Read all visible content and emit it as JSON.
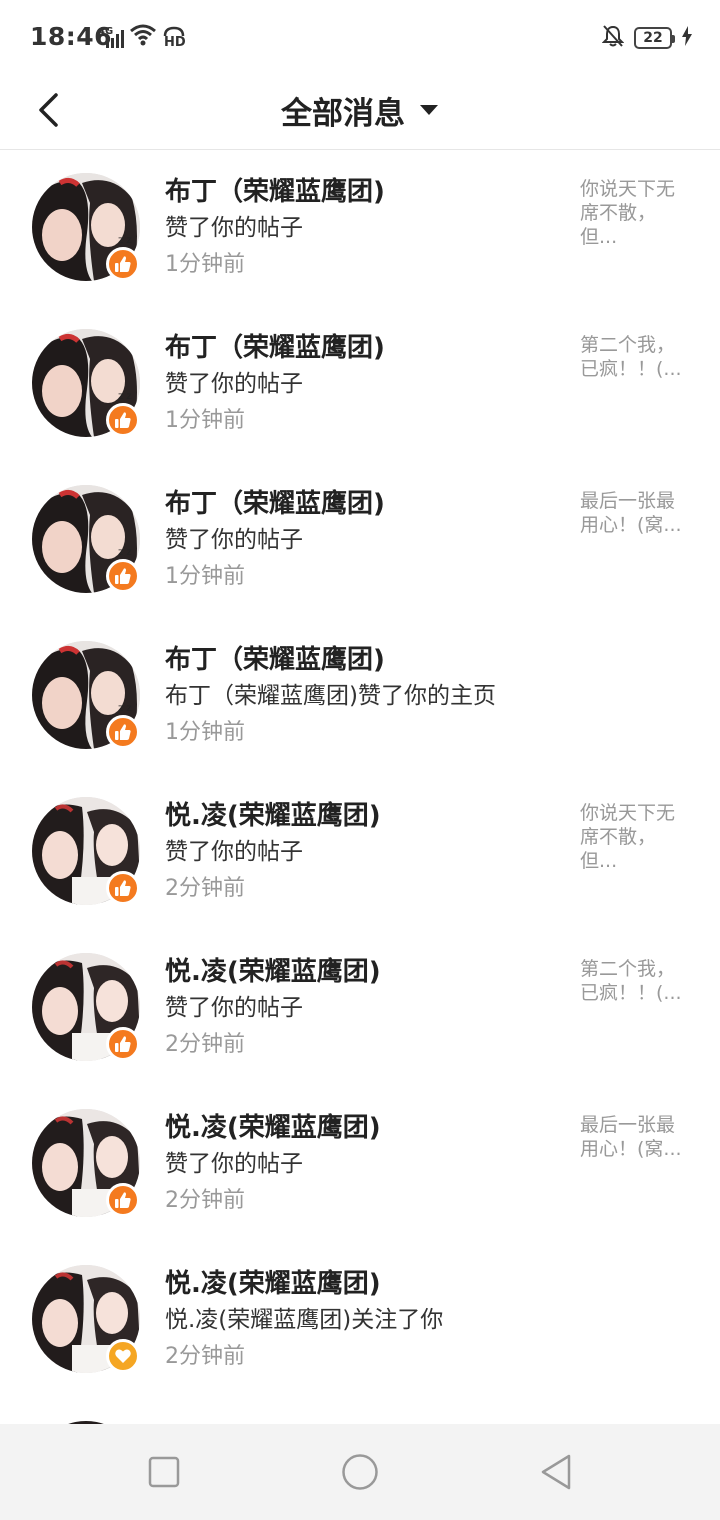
{
  "status_bar": {
    "time": "18:46",
    "network_label": "4G",
    "hd_label": "HD",
    "battery_level": "22"
  },
  "header": {
    "title": "全部消息"
  },
  "messages": [
    {
      "name": "布丁（荣耀蓝鹰团)",
      "action": "赞了你的帖子",
      "time": "1分钟前",
      "preview": "你说天下无席不散，但...",
      "badge": "like-icon"
    },
    {
      "name": "布丁（荣耀蓝鹰团)",
      "action": "赞了你的帖子",
      "time": "1分钟前",
      "preview": "第二个我，已疯！！(...",
      "badge": "like-icon"
    },
    {
      "name": "布丁（荣耀蓝鹰团)",
      "action": "赞了你的帖子",
      "time": "1分钟前",
      "preview": "最后一张最用心！(窝...",
      "badge": "like-icon"
    },
    {
      "name": "布丁（荣耀蓝鹰团)",
      "action": "布丁（荣耀蓝鹰团)赞了你的主页",
      "time": "1分钟前",
      "preview": "",
      "badge": "like-icon"
    },
    {
      "name": "悦.凌(荣耀蓝鹰团)",
      "action": "赞了你的帖子",
      "time": "2分钟前",
      "preview": "你说天下无席不散，但...",
      "badge": "like-icon"
    },
    {
      "name": "悦.凌(荣耀蓝鹰团)",
      "action": "赞了你的帖子",
      "time": "2分钟前",
      "preview": "第二个我，已疯！！(...",
      "badge": "like-icon"
    },
    {
      "name": "悦.凌(荣耀蓝鹰团)",
      "action": "赞了你的帖子",
      "time": "2分钟前",
      "preview": "最后一张最用心！(窝...",
      "badge": "like-icon"
    },
    {
      "name": "悦.凌(荣耀蓝鹰团)",
      "action": "悦.凌(荣耀蓝鹰团)关注了你",
      "time": "2分钟前",
      "preview": "",
      "badge": "heart-icon"
    }
  ],
  "colors": {
    "like_badge": "#f47a1f",
    "follow_badge": "#f5a623",
    "time_text": "#999999"
  }
}
